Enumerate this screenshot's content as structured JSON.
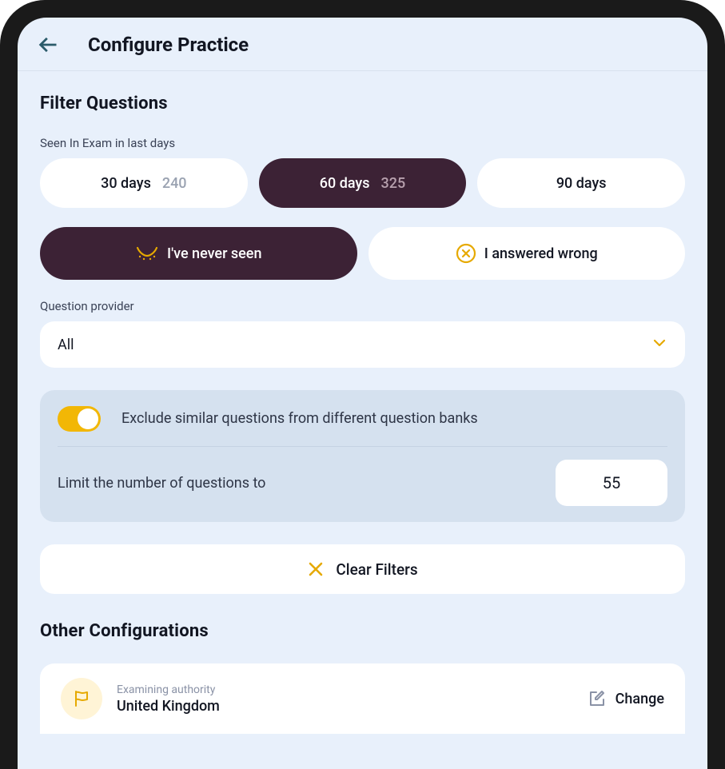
{
  "header": {
    "title": "Configure Practice"
  },
  "filter": {
    "section_title": "Filter Questions",
    "seen_label": "Seen In Exam in last days",
    "days": [
      {
        "label": "30 days",
        "count": "240",
        "selected": false
      },
      {
        "label": "60 days",
        "count": "325",
        "selected": true
      },
      {
        "label": "90 days",
        "count": "",
        "selected": false
      }
    ],
    "status": {
      "never_seen": "I've never seen",
      "answered_wrong": "I answered wrong"
    },
    "provider_label": "Question provider",
    "provider_value": "All",
    "exclude_label": "Exclude similar questions from different question banks",
    "limit_label": "Limit the number of questions to",
    "limit_value": "55",
    "clear_label": "Clear Filters"
  },
  "other": {
    "section_title": "Other Configurations",
    "authority_sub": "Examining authority",
    "authority_value": "United Kingdom",
    "change_label": "Change"
  }
}
